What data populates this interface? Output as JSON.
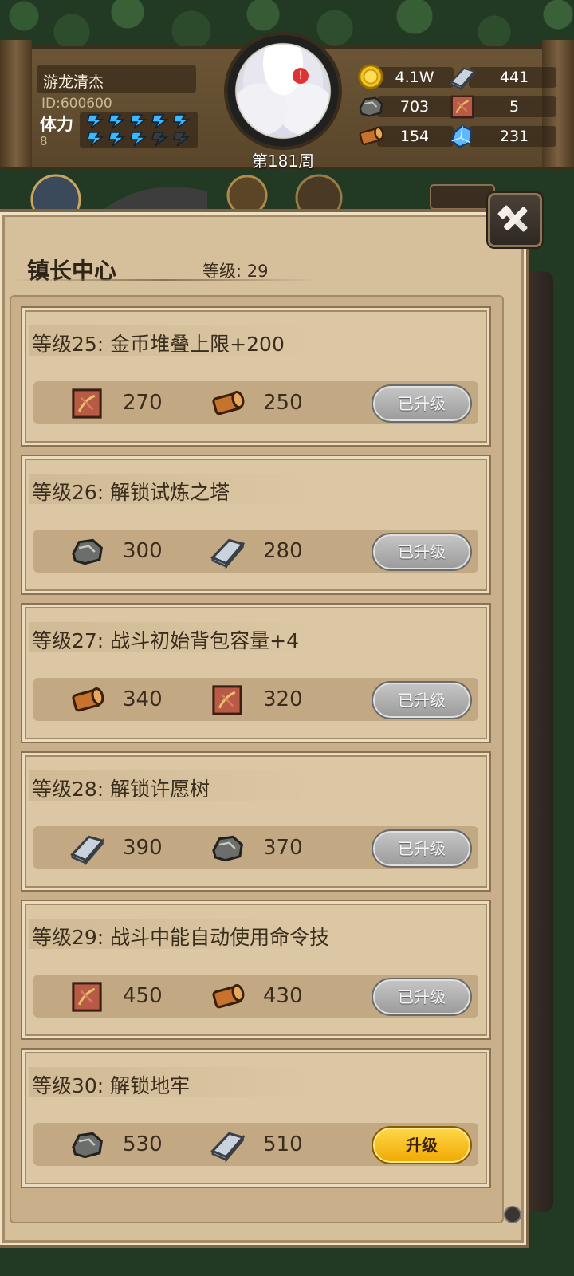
{
  "player": {
    "name": "游龙清杰",
    "id_text": "ID:600600",
    "stamina_label": "体力",
    "stamina_value": "8",
    "stamina_bars_filled": 8,
    "stamina_bars_total": 10
  },
  "avatar": {
    "week_label": "第181周",
    "anger_badge": "!"
  },
  "resources": [
    {
      "name": "gold-coin-icon",
      "value": "4.1W"
    },
    {
      "name": "steel-ingot-icon",
      "value": "441"
    },
    {
      "name": "stone-ore-icon",
      "value": "703"
    },
    {
      "name": "leather-hide-icon",
      "value": "5"
    },
    {
      "name": "wood-log-icon",
      "value": "154"
    },
    {
      "name": "crystal-gem-icon",
      "value": "231"
    }
  ],
  "panel": {
    "title": "镇长中心",
    "level_label": "等级: 29"
  },
  "upgrades": [
    {
      "title": "等级25: 金币堆叠上限+200",
      "costs": [
        {
          "icon": "leather-hide-icon",
          "value": "270"
        },
        {
          "icon": "wood-log-icon",
          "value": "250"
        }
      ],
      "button": "已升级",
      "done": true
    },
    {
      "title": "等级26: 解锁试炼之塔",
      "costs": [
        {
          "icon": "stone-ore-icon",
          "value": "300"
        },
        {
          "icon": "steel-ingot-icon",
          "value": "280"
        }
      ],
      "button": "已升级",
      "done": true
    },
    {
      "title": "等级27: 战斗初始背包容量+4",
      "costs": [
        {
          "icon": "wood-log-icon",
          "value": "340"
        },
        {
          "icon": "leather-hide-icon",
          "value": "320"
        }
      ],
      "button": "已升级",
      "done": true
    },
    {
      "title": "等级28: 解锁许愿树",
      "costs": [
        {
          "icon": "steel-ingot-icon",
          "value": "390"
        },
        {
          "icon": "stone-ore-icon",
          "value": "370"
        }
      ],
      "button": "已升级",
      "done": true
    },
    {
      "title": "等级29: 战斗中能自动使用命令技",
      "costs": [
        {
          "icon": "leather-hide-icon",
          "value": "450"
        },
        {
          "icon": "wood-log-icon",
          "value": "430"
        }
      ],
      "button": "已升级",
      "done": true
    },
    {
      "title": "等级30: 解锁地牢",
      "costs": [
        {
          "icon": "stone-ore-icon",
          "value": "530"
        },
        {
          "icon": "steel-ingot-icon",
          "value": "510"
        }
      ],
      "button": "升级",
      "done": false
    }
  ],
  "colors": {
    "parchment": "#d6c09c",
    "button_done": "#9a9a9a",
    "button_upgrade": "#f0a800",
    "stamina_bolt": "#3fb7ff"
  }
}
